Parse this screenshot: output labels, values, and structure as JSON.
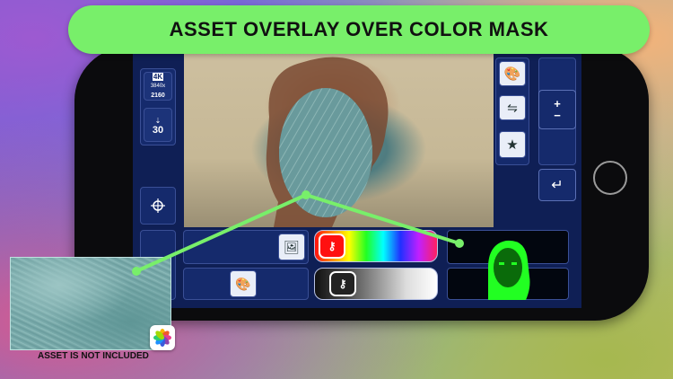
{
  "banner": {
    "title": "ASSET OVERLAY OVER COLOR MASK"
  },
  "left_toolbar": {
    "resolution_badge_top": "4K",
    "resolution_badge_res": "3840x\n2160",
    "fps_label": "30"
  },
  "right_toolbar": {
    "zoom_plus": "+",
    "zoom_minus": "−",
    "back_label": "↵"
  },
  "caption": {
    "asset_note": "ASSET IS NOT INCLUDED"
  },
  "colors": {
    "banner_green": "#78ef6a",
    "screen_navy": "#0f1f55",
    "mask_green": "#22ff22",
    "key_red": "#ff1010"
  },
  "icons": [
    "4k-resolution-icon",
    "fps-icon",
    "crosshair-icon",
    "palette-icon",
    "flip-icon",
    "star-effects-icon",
    "image-asset-icon",
    "key-icon",
    "enter-icon",
    "photos-app-icon"
  ]
}
